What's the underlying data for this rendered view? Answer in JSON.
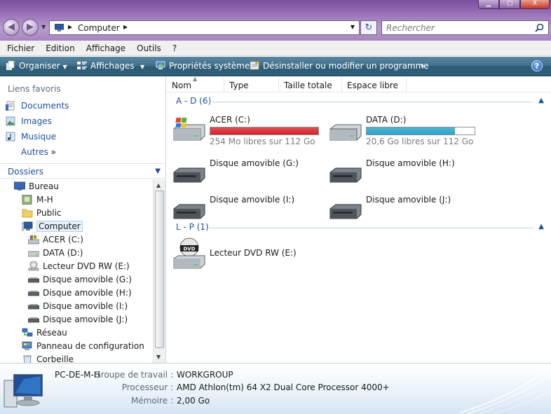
{
  "window": {
    "minimize_glyph": "▁",
    "maximize_glyph": "□",
    "close_glyph": "X"
  },
  "address": {
    "path": "Computer",
    "search_placeholder": "Rechercher"
  },
  "menu": [
    "Fichier",
    "Edition",
    "Affichage",
    "Outils",
    "?"
  ],
  "toolbar": {
    "organize": "Organiser",
    "views": "Affichages",
    "system_properties": "Propriétés système",
    "uninstall": "Désinstaller ou modifier un programme",
    "more": "»"
  },
  "sidebar": {
    "favorites_title": "Liens favoris",
    "favorites": [
      "Documents",
      "Images",
      "Musique"
    ],
    "more_label": "Autres",
    "more_chevron": "»",
    "folders_title": "Dossiers",
    "tree": [
      "Bureau",
      "M-H",
      "Public",
      "Computer",
      "ACER (C:)",
      "DATA (D:)",
      "Lecteur DVD RW (E:)",
      "Disque amovible (G:)",
      "Disque amovible (H:)",
      "Disque amovible (I:)",
      "Disque amovible (J:)",
      "Réseau",
      "Panneau de configuration",
      "Corbeille"
    ]
  },
  "columns": [
    "Nom",
    "Type",
    "Taille totale",
    "Espace libre"
  ],
  "groups": [
    {
      "label": "A - D (6)",
      "drives": [
        {
          "name": "ACER (C:)",
          "free": "254 Mo libres sur 112 Go",
          "used_fraction": 0.998,
          "bar_color": "#d8232a"
        },
        {
          "name": "DATA (D:)",
          "free": "20,6 Go libres sur 112 Go",
          "used_fraction": 0.82,
          "bar_color": "#2aa3c7"
        },
        {
          "name": "Disque amovible (G:)"
        },
        {
          "name": "Disque amovible (H:)"
        },
        {
          "name": "Disque amovible (I:)"
        },
        {
          "name": "Disque amovible (J:)"
        }
      ]
    },
    {
      "label": "L - P (1)",
      "drives": [
        {
          "name": "Lecteur DVD RW (E:)"
        }
      ]
    }
  ],
  "details": {
    "computer_name": "PC-DE-M-H",
    "workgroup_label": "Groupe de travail :",
    "workgroup": "WORKGROUP",
    "processor_label": "Processeur :",
    "processor": "AMD Athlon(tm) 64 X2 Dual Core Processor 4000+",
    "memory_label": "Mémoire :",
    "memory": "2,00 Go"
  }
}
